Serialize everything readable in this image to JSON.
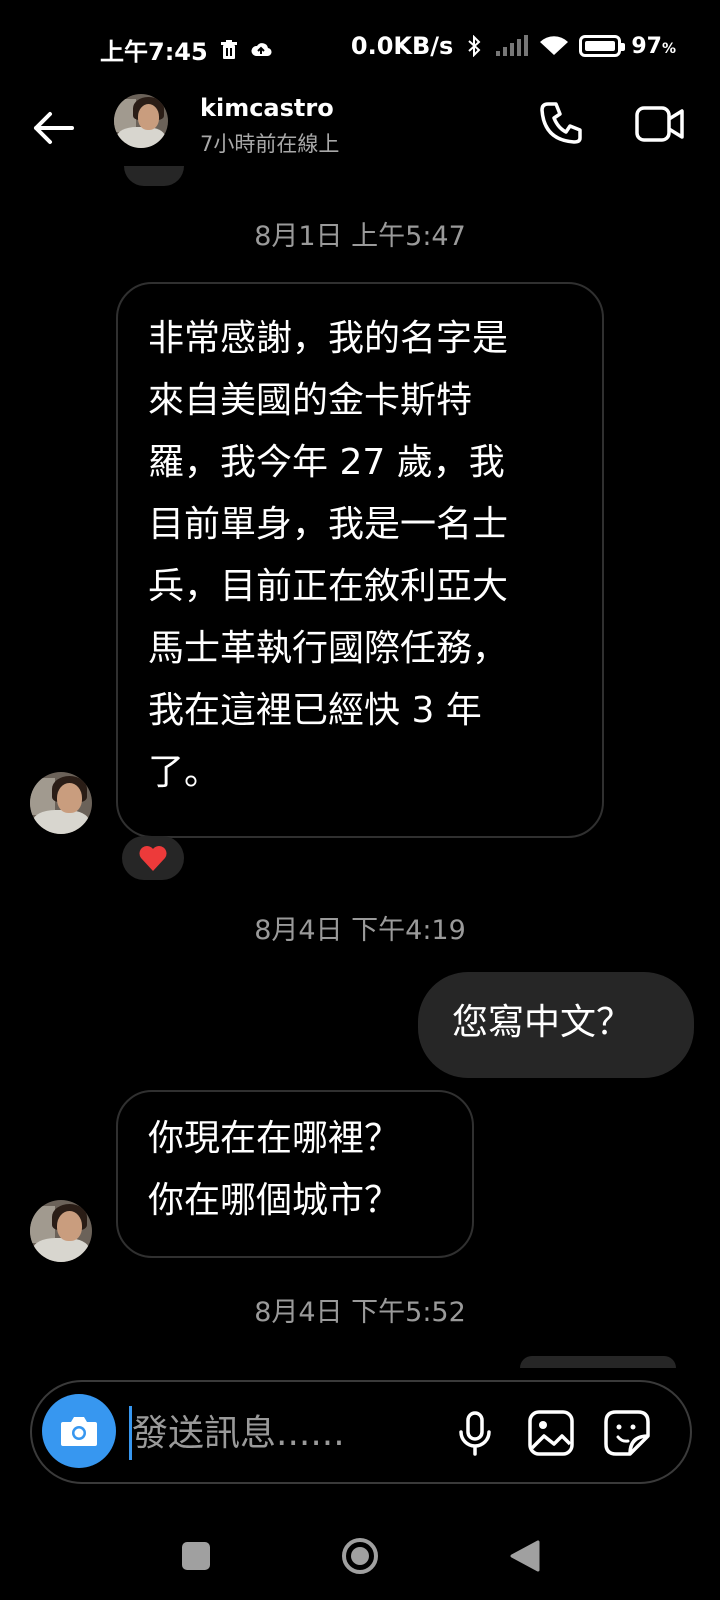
{
  "status_bar": {
    "time": "上午7:45",
    "speed": "0.0KB/s",
    "battery_pct": "97",
    "battery_unit": "%"
  },
  "header": {
    "name": "kimcastro",
    "status": "7小時前在線上"
  },
  "messages": [
    {
      "timestamp": "8月1日 上午5:47",
      "direction": "incoming",
      "text": "非常感謝，我的名字是\n來自美國的金卡斯特\n羅，我今年 27 歲，我\n目前單身，我是一名士\n兵，目前正在敘利亞大\n馬士革執行國際任務，\n我在這裡已經快 3 年\n了。",
      "reaction": "❤️"
    },
    {
      "timestamp": "8月4日 下午4:19",
      "direction": "outgoing",
      "text": "您寫中文？"
    },
    {
      "direction": "incoming",
      "text": "你現在在哪裡？\n你在哪個城市？"
    }
  ],
  "last_timestamp": "8月4日 下午5:52",
  "composer": {
    "placeholder": "發送訊息......"
  },
  "colors": {
    "background": "#000000",
    "outgoing_bubble": "#262626",
    "incoming_border": "#303030",
    "accent": "#3797f0",
    "timestamp": "#9a9a9a"
  },
  "icons": [
    "arrow-left-icon",
    "phone-icon",
    "video-camera-icon",
    "camera-icon",
    "microphone-icon",
    "image-icon",
    "sticker-icon",
    "trash-icon",
    "cloud-upload-icon",
    "bluetooth-icon",
    "signal-icon",
    "wifi-icon",
    "battery-icon"
  ]
}
